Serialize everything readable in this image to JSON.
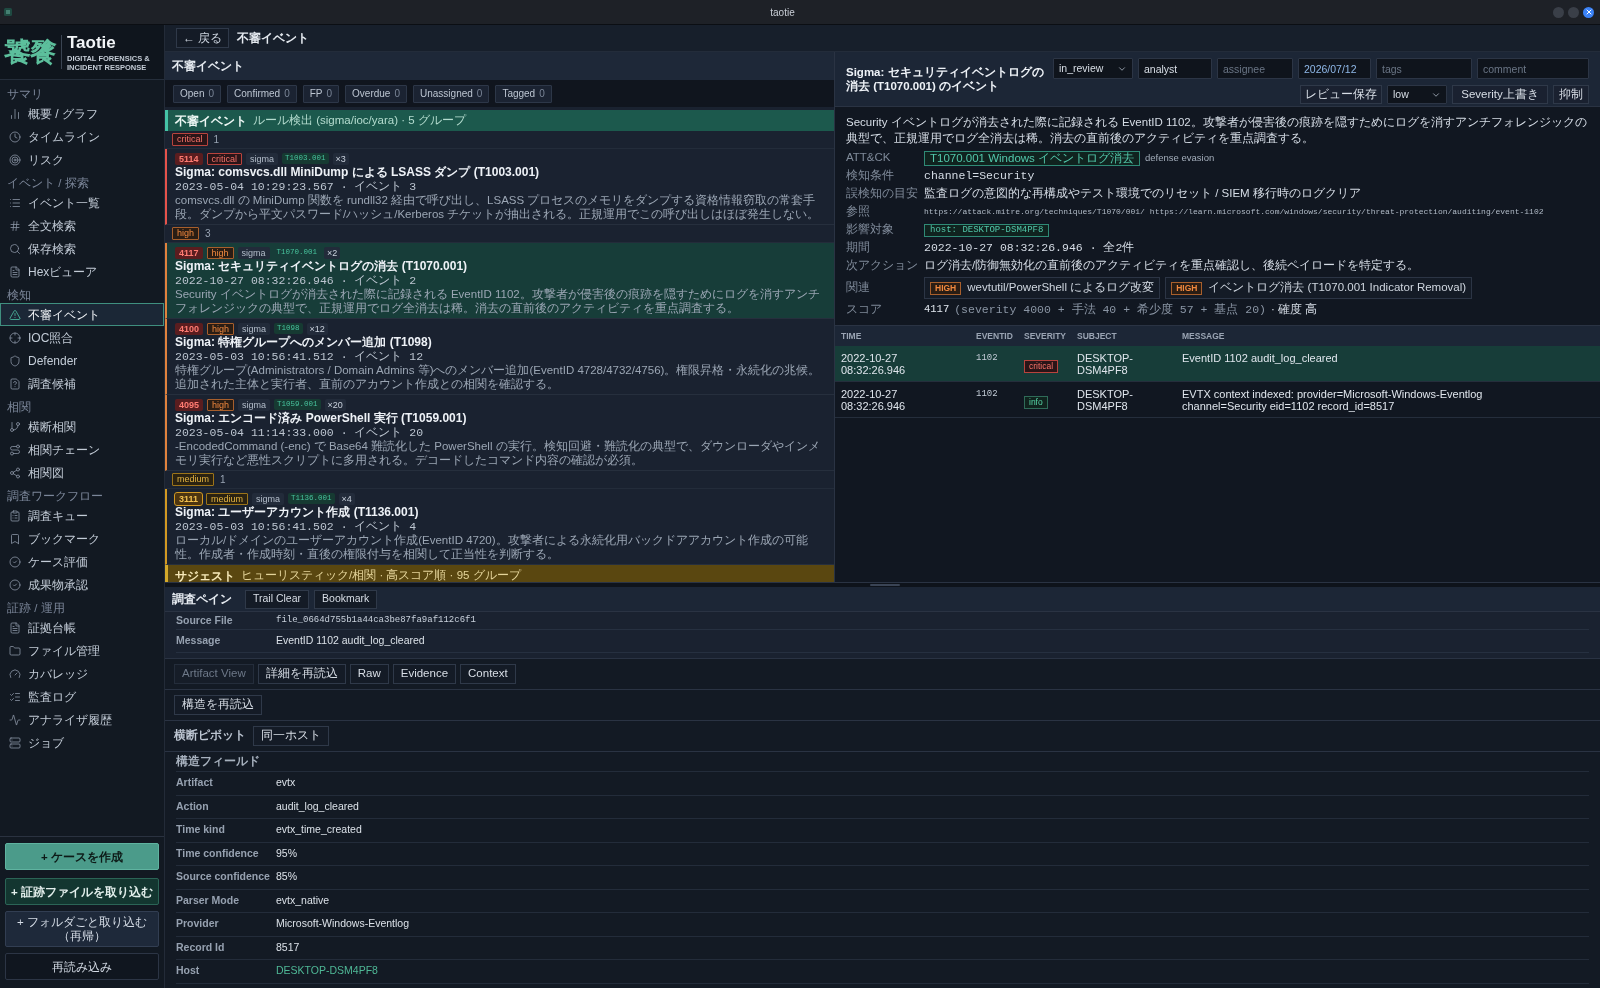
{
  "window": {
    "title": "taotie"
  },
  "sidebar": {
    "logo": {
      "mark": "饕餮",
      "name": "Taotie",
      "tagline": "DIGITAL FORENSICS & INCIDENT RESPONSE"
    },
    "sections": [
      {
        "title": "サマリ",
        "items": [
          {
            "label": "概要 / グラフ",
            "selected": false
          },
          {
            "label": "タイムライン",
            "selected": false
          },
          {
            "label": "リスク",
            "selected": false
          }
        ]
      },
      {
        "title": "イベント / 探索",
        "items": [
          {
            "label": "イベント一覧",
            "selected": false
          },
          {
            "label": "全文検索",
            "selected": false
          },
          {
            "label": "保存検索",
            "selected": false
          },
          {
            "label": "Hexビューア",
            "selected": false
          }
        ]
      },
      {
        "title": "検知",
        "items": [
          {
            "label": "不審イベント",
            "selected": true
          },
          {
            "label": "IOC照合",
            "selected": false
          },
          {
            "label": "Defender",
            "selected": false
          },
          {
            "label": "調査候補",
            "selected": false
          }
        ]
      },
      {
        "title": "相関",
        "items": [
          {
            "label": "横断相関",
            "selected": false
          },
          {
            "label": "相関チェーン",
            "selected": false
          },
          {
            "label": "相関図",
            "selected": false
          }
        ]
      },
      {
        "title": "調査ワークフロー",
        "items": [
          {
            "label": "調査キュー",
            "selected": false
          },
          {
            "label": "ブックマーク",
            "selected": false
          },
          {
            "label": "ケース評価",
            "selected": false
          },
          {
            "label": "成果物承認",
            "selected": false
          }
        ]
      },
      {
        "title": "証跡 / 運用",
        "items": [
          {
            "label": "証拠台帳",
            "selected": false
          },
          {
            "label": "ファイル管理",
            "selected": false
          },
          {
            "label": "カバレッジ",
            "selected": false
          },
          {
            "label": "監査ログ",
            "selected": false
          },
          {
            "label": "アナライザ履歴",
            "selected": false
          },
          {
            "label": "ジョブ",
            "selected": false
          }
        ]
      }
    ],
    "actions": [
      {
        "label": "+ ケースを作成",
        "kind": "primary"
      },
      {
        "label": "+ 証跡ファイルを取り込む",
        "kind": "secondary"
      },
      {
        "label": "+ フォルダごと取り込む（再帰）",
        "kind": "tertiary"
      },
      {
        "label": "再読み込み",
        "kind": "outline"
      }
    ]
  },
  "topbar": {
    "back": "← 戻る",
    "title": "不審イベント"
  },
  "list": {
    "title": "不審イベント",
    "filters": [
      {
        "label": "Open",
        "count": "0",
        "selected": false
      },
      {
        "label": "Confirmed",
        "count": "0",
        "selected": false
      },
      {
        "label": "FP",
        "count": "0",
        "selected": false
      },
      {
        "label": "Overdue",
        "count": "0",
        "selected": false
      },
      {
        "label": "Unassigned",
        "count": "0",
        "selected": false
      },
      {
        "label": "Tagged",
        "count": "0",
        "selected": false
      }
    ],
    "groups": [
      {
        "kind": "rules",
        "title": "不審イベント",
        "subtitle": "ルール検出 (sigma/ioc/yara) · 5 グループ",
        "severities": [
          {
            "kind": "critical",
            "severity": "critical",
            "count": "1",
            "events": [
              {
                "score": "5114",
                "severity": "critical",
                "source": "sigma",
                "technique": "T1003.001",
                "count": "×3",
                "title": "Sigma: comsvcs.dll MiniDump による LSASS ダンプ (T1003.001)",
                "meta": "2023-05-04 10:29:23.567 · イベント 3",
                "description": "comsvcs.dll の MiniDump 関数を rundll32 経由で呼び出し、LSASS プロセスのメモリをダンプする資格情報窃取の常套手段。ダンプから平文パスワード/ハッシュ/Kerberos チケットが抽出される。正規運用でこの呼び出しはほぼ発生しない。",
                "selected": false
              }
            ]
          },
          {
            "kind": "high",
            "severity": "high",
            "count": "3",
            "events": [
              {
                "score": "4117",
                "severity": "high",
                "source": "sigma",
                "technique": "T1070.001",
                "count": "×2",
                "title": "Sigma: セキュリティイベントログの消去 (T1070.001)",
                "meta": "2022-10-27 08:32:26.946 · イベント 2",
                "description": "Security イベントログが消去された際に記録される EventID 1102。攻撃者が侵害後の痕跡を隠すためにログを消すアンチフォレンジックの典型で、正規運用でログ全消去は稀。消去の直前後のアクティビティを重点調査する。",
                "selected": true
              },
              {
                "score": "4100",
                "severity": "high",
                "source": "sigma",
                "technique": "T1098",
                "count": "×12",
                "title": "Sigma: 特権グループへのメンバー追加 (T1098)",
                "meta": "2023-05-03 10:56:41.512 · イベント 12",
                "description": "特権グループ(Administrators / Domain Admins 等)へのメンバー追加(EventID 4728/4732/4756)。権限昇格・永続化の兆候。追加された主体と実行者、直前のアカウント作成との相関を確認する。",
                "selected": false
              },
              {
                "score": "4095",
                "severity": "high",
                "source": "sigma",
                "technique": "T1059.001",
                "count": "×20",
                "title": "Sigma: エンコード済み PowerShell 実行 (T1059.001)",
                "meta": "2023-05-04 11:14:33.000 · イベント 20",
                "description": "-EncodedCommand (-enc) で Base64 難読化した PowerShell の実行。検知回避・難読化の典型で、ダウンローダやインメモリ実行など悪性スクリプトに多用される。デコードしたコマンド内容の確認が必須。",
                "selected": false
              }
            ]
          },
          {
            "kind": "medium",
            "severity": "medium",
            "count": "1",
            "events": [
              {
                "score": "3111",
                "severity": "medium",
                "source": "sigma",
                "technique": "T1136.001",
                "count": "×4",
                "title": "Sigma: ユーザーアカウント作成 (T1136.001)",
                "meta": "2023-05-03 10:56:41.502 · イベント 4",
                "description": "ローカル/ドメインのユーザーアカウント作成(EventID 4720)。攻撃者による永続化用バックドアアカウント作成の可能性。作成者・作成時刻・直後の権限付与を相関して正当性を判断する。",
                "selected": false
              }
            ]
          }
        ]
      },
      {
        "kind": "suggest",
        "title": "サジェスト",
        "subtitle": "ヒューリスティック/相関 · 高スコア順 · 95 グループ"
      }
    ]
  },
  "detail": {
    "title": "Sigma: セキュリティイベントログの消去 (T1070.001) のイベント",
    "status": {
      "value": "in_review"
    },
    "analyst": {
      "value": "analyst"
    },
    "assignee": {
      "placeholder": "assignee"
    },
    "date": {
      "value": "2026/07/12"
    },
    "tags": {
      "placeholder": "tags"
    },
    "comment": {
      "placeholder": "comment"
    },
    "save_button": "レビュー保存",
    "severity_select": {
      "value": "low"
    },
    "override_button": "Severity上書き",
    "suppress_button": "抑制",
    "description": "Security イベントログが消去された際に記録される EventID 1102。攻撃者が侵害後の痕跡を隠すためにログを消すアンチフォレンジックの典型で、正規運用でログ全消去は稀。消去の直前後のアクティビティを重点調査する。",
    "fields": [
      {
        "label": "ATT&CK",
        "kind": "attack",
        "tag": "T1070.001 Windows イベントログ消去",
        "text": "defense evasion"
      },
      {
        "label": "検知条件",
        "kind": "code",
        "text": "channel=Security"
      },
      {
        "label": "誤検知の目安",
        "kind": "text",
        "text": "監査ログの意図的な再構成やテスト環境でのリセット / SIEM 移行時のログクリア"
      },
      {
        "label": "参照",
        "kind": "links",
        "links": [
          "https://attack.mitre.org/techniques/T1070/001/",
          "https://learn.microsoft.com/windows/security/threat-protection/auditing/event-1102"
        ]
      },
      {
        "label": "影響対象",
        "kind": "target",
        "tag": "host: DESKTOP-DSM4PF8"
      },
      {
        "label": "期間",
        "kind": "code",
        "text": "2022-10-27 08:32:26.946 · 全2件"
      },
      {
        "label": "次アクション",
        "kind": "text",
        "text": "ログ消去/防御無効化の直前後のアクティビティを重点確認し、後続ペイロードを特定する。"
      },
      {
        "label": "関連",
        "kind": "related",
        "items": [
          {
            "severity": "HIGH",
            "kind": "high",
            "text": "wevtutil/PowerShell によるログ改変"
          },
          {
            "severity": "HIGH",
            "kind": "high",
            "text": "イベントログ消去 (T1070.001 Indicator Removal)"
          }
        ]
      },
      {
        "label": "スコア",
        "kind": "score",
        "score": "4117",
        "breakdown": "(severity 4000 + 手法 40 + 希少度 57 + 基点 20)",
        "confidence": "· 確度 高"
      }
    ]
  },
  "events_table": {
    "columns": [
      "TIME",
      "EVENTID",
      "SEVERITY",
      "SUBJECT",
      "MESSAGE"
    ],
    "rows": [
      {
        "time": "2022-10-27 08:32:26.946",
        "event_id": "1102",
        "severity": "critical",
        "kind": "critical",
        "subject": "DESKTOP-DSM4PF8",
        "message": "EventID 1102 audit_log_cleared",
        "selected": true
      },
      {
        "time": "2022-10-27 08:32:26.946",
        "event_id": "1102",
        "severity": "info",
        "kind": "info",
        "subject": "DESKTOP-DSM4PF8",
        "message": "EVTX context indexed: provider=Microsoft-Windows-Eventlog channel=Security eid=1102 record_id=8517",
        "selected": false
      }
    ]
  },
  "investigation": {
    "title": "調査ペイン",
    "buttons": [
      "Trail Clear",
      "Bookmark"
    ],
    "summary": [
      {
        "label": "Source File",
        "value": "file_0664d755b1a44ca3be87fa9af112c6f1",
        "kind": "code"
      },
      {
        "label": "Message",
        "value": "EventID 1102 audit_log_cleared",
        "kind": "text"
      }
    ],
    "view_tabs": [
      {
        "label": "Artifact View",
        "disabled": true
      },
      {
        "label": "詳細を再読込",
        "disabled": false
      },
      {
        "label": "Raw",
        "disabled": false
      },
      {
        "label": "Evidence",
        "disabled": false
      },
      {
        "label": "Context",
        "disabled": false
      }
    ],
    "reload_structure": "構造を再読込",
    "pivot": {
      "label": "横断ピボット",
      "buttons": [
        "同一ホスト"
      ]
    },
    "fields_title": "構造フィールド",
    "fields": [
      {
        "label": "Artifact",
        "value": "evtx",
        "kind": "text"
      },
      {
        "label": "Action",
        "value": "audit_log_cleared",
        "kind": "text"
      },
      {
        "label": "Time kind",
        "value": "evtx_time_created",
        "kind": "text"
      },
      {
        "label": "Time confidence",
        "value": "95%",
        "kind": "text"
      },
      {
        "label": "Source confidence",
        "value": "85%",
        "kind": "text"
      },
      {
        "label": "Parser Mode",
        "value": "evtx_native",
        "kind": "text"
      },
      {
        "label": "Provider",
        "value": "Microsoft-Windows-Eventlog",
        "kind": "text"
      },
      {
        "label": "Record Id",
        "value": "8517",
        "kind": "text"
      },
      {
        "label": "Host",
        "value": "DESKTOP-DSM4PF8",
        "kind": "link"
      }
    ]
  }
}
